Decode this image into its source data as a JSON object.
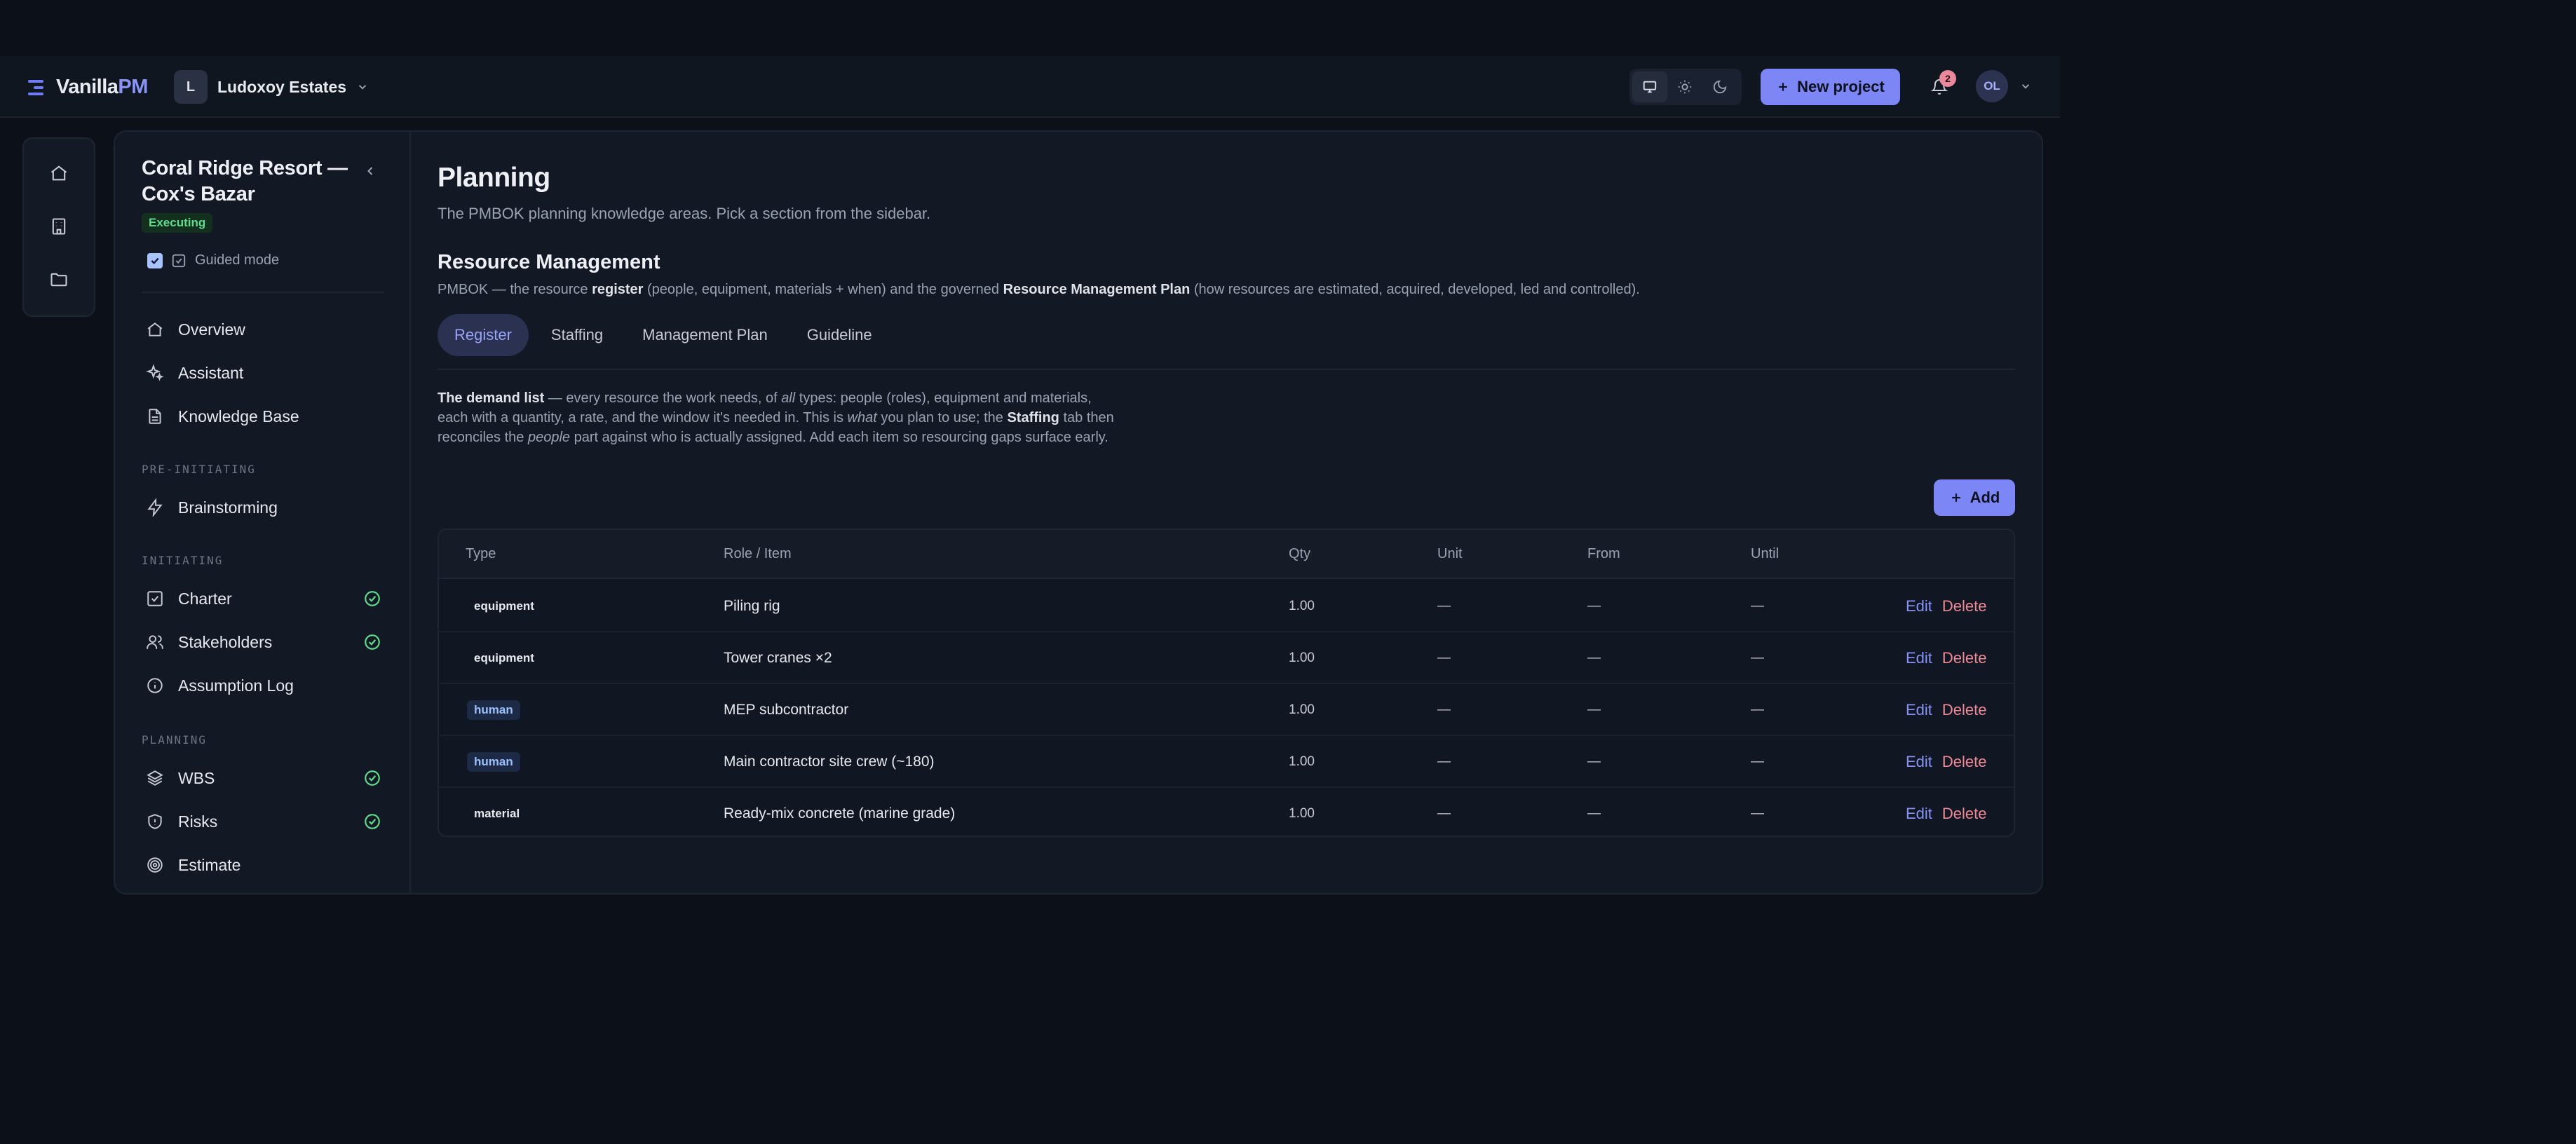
{
  "header": {
    "logo_prefix": "Vanilla",
    "logo_suffix": "PM",
    "workspace_initial": "L",
    "workspace_name": "Ludoxoy Estates",
    "new_project_label": "New project",
    "notification_count": "2",
    "user_initials": "OL",
    "theme_options": [
      "monitor-icon",
      "sun-icon",
      "moon-icon"
    ],
    "active_theme": "monitor-icon"
  },
  "rail": [
    "home-icon",
    "building-icon",
    "folder-icon"
  ],
  "project": {
    "title": "Coral Ridge Resort — Cox's Bazar",
    "status": "Executing",
    "guided_mode_label": "Guided mode",
    "guided_mode_checked": true
  },
  "sidebar": {
    "top_items": [
      {
        "label": "Overview",
        "icon": "home-icon"
      },
      {
        "label": "Assistant",
        "icon": "sparkles-icon"
      },
      {
        "label": "Knowledge Base",
        "icon": "document-icon"
      }
    ],
    "sections": [
      {
        "label": "PRE-INITIATING",
        "items": [
          {
            "label": "Brainstorming",
            "icon": "lightning-icon",
            "done": false
          }
        ]
      },
      {
        "label": "INITIATING",
        "items": [
          {
            "label": "Charter",
            "icon": "checkbox-icon",
            "done": true
          },
          {
            "label": "Stakeholders",
            "icon": "users-icon",
            "done": true
          },
          {
            "label": "Assumption Log",
            "icon": "info-icon",
            "done": false
          }
        ]
      },
      {
        "label": "PLANNING",
        "items": [
          {
            "label": "WBS",
            "icon": "layers-icon",
            "done": true
          },
          {
            "label": "Risks",
            "icon": "shield-icon",
            "done": true
          },
          {
            "label": "Estimate",
            "icon": "target-icon",
            "done": false
          }
        ]
      }
    ]
  },
  "main": {
    "title": "Planning",
    "subtitle": "The PMBOK planning knowledge areas. Pick a section from the sidebar.",
    "section_title": "Resource Management",
    "section_desc": {
      "p1": "PMBOK — the resource ",
      "b1": "register",
      "p2": " (people, equipment, materials + when) and the governed ",
      "b2": "Resource Management Plan",
      "p3": " (how resources are estimated, acquired, developed, led and controlled)."
    },
    "tabs": [
      "Register",
      "Staffing",
      "Management Plan",
      "Guideline"
    ],
    "active_tab": "Register",
    "intro": {
      "b1": "The demand list",
      "p1": " — every resource the work needs, of ",
      "i1": "all",
      "p2": " types: people (roles), equipment and materials, each with a quantity, a rate, and the window it's needed in. This is ",
      "i2": "what",
      "p3": " you plan to use; the ",
      "b2": "Staffing",
      "p4": " tab then reconciles the ",
      "i3": "people",
      "p5": " part against who is actually assigned. Add each item so resourcing gaps surface early."
    },
    "add_label": "Add"
  },
  "table": {
    "columns": [
      "Type",
      "Role / Item",
      "Qty",
      "Unit",
      "From",
      "Until"
    ],
    "edit_label": "Edit",
    "delete_label": "Delete",
    "rows": [
      {
        "type": "equipment",
        "item": "Piling rig",
        "qty": "1.00",
        "unit": "—",
        "from": "—",
        "until": "—"
      },
      {
        "type": "equipment",
        "item": "Tower cranes ×2",
        "qty": "1.00",
        "unit": "—",
        "from": "—",
        "until": "—"
      },
      {
        "type": "human",
        "item": "MEP subcontractor",
        "qty": "1.00",
        "unit": "—",
        "from": "—",
        "until": "—"
      },
      {
        "type": "human",
        "item": "Main contractor site crew (~180)",
        "qty": "1.00",
        "unit": "—",
        "from": "—",
        "until": "—"
      },
      {
        "type": "material",
        "item": "Ready-mix concrete (marine grade)",
        "qty": "1.00",
        "unit": "—",
        "from": "—",
        "until": "—"
      }
    ]
  },
  "colors": {
    "accent": "#7c86f5",
    "success": "#5fdc8c",
    "danger": "#f08a96",
    "background": "#0b1019"
  }
}
